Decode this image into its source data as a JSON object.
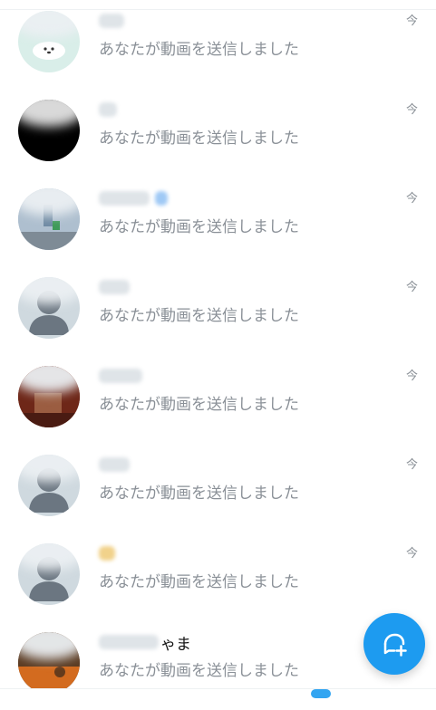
{
  "conversations": [
    {
      "name_visible": "",
      "name_obscured_width": 28,
      "message": "あなたが動画を送信しました",
      "time": "今",
      "avatar_style": "seal"
    },
    {
      "name_visible": "",
      "name_obscured_width": 20,
      "message": "あなたが動画を送信しました",
      "time": "今",
      "avatar_style": "dark"
    },
    {
      "name_visible": "",
      "name_obscured_width": 56,
      "message": "あなたが動画を送信しました",
      "time": "今",
      "avatar_style": "photo-gray"
    },
    {
      "name_visible": "",
      "name_obscured_width": 34,
      "message": "あなたが動画を送信しました",
      "time": "今",
      "avatar_style": "default"
    },
    {
      "name_visible": "",
      "name_obscured_width": 48,
      "message": "あなたが動画を送信しました",
      "time": "今",
      "avatar_style": "photo-brown"
    },
    {
      "name_visible": "",
      "name_obscured_width": 34,
      "message": "あなたが動画を送信しました",
      "time": "今",
      "avatar_style": "default"
    },
    {
      "name_visible": "",
      "name_obscured_width": 18,
      "message": "あなたが動画を送信しました",
      "time": "今",
      "avatar_style": "default"
    },
    {
      "name_visible": "ゃま",
      "name_obscured_width": 66,
      "message": "あなたが動画を送信しました",
      "time": "",
      "avatar_style": "photo-orange"
    }
  ],
  "fab": {
    "icon": "new-message-icon",
    "color": "#1d9bf0"
  }
}
